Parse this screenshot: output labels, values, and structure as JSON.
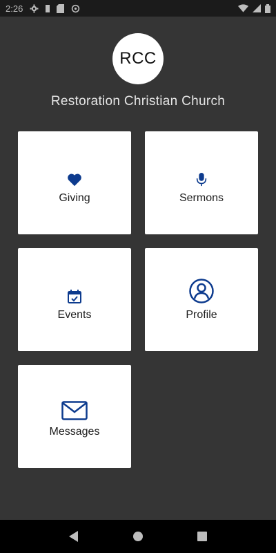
{
  "status_bar": {
    "time": "2:26",
    "icons": [
      "gear-icon",
      "battery-small-icon",
      "sd-card-icon",
      "sync-icon",
      "wifi-icon",
      "cellular-signal-icon",
      "battery-icon"
    ]
  },
  "header": {
    "logo_text": "RCC",
    "church_name": "Restoration Christian Church"
  },
  "tiles": [
    {
      "label": "Giving",
      "icon": "heart-icon"
    },
    {
      "label": "Sermons",
      "icon": "microphone-icon"
    },
    {
      "label": "Events",
      "icon": "calendar-icon"
    },
    {
      "label": "Profile",
      "icon": "profile-icon"
    },
    {
      "label": "Messages",
      "icon": "envelope-icon"
    }
  ],
  "navigation": {
    "buttons": [
      "back-icon",
      "home-icon",
      "recents-icon"
    ]
  },
  "colors": {
    "background": "#353535",
    "accent": "#0d3b8e",
    "tile": "#ffffff",
    "status_bar": "#1b1b1b",
    "nav_bar": "#000000"
  }
}
